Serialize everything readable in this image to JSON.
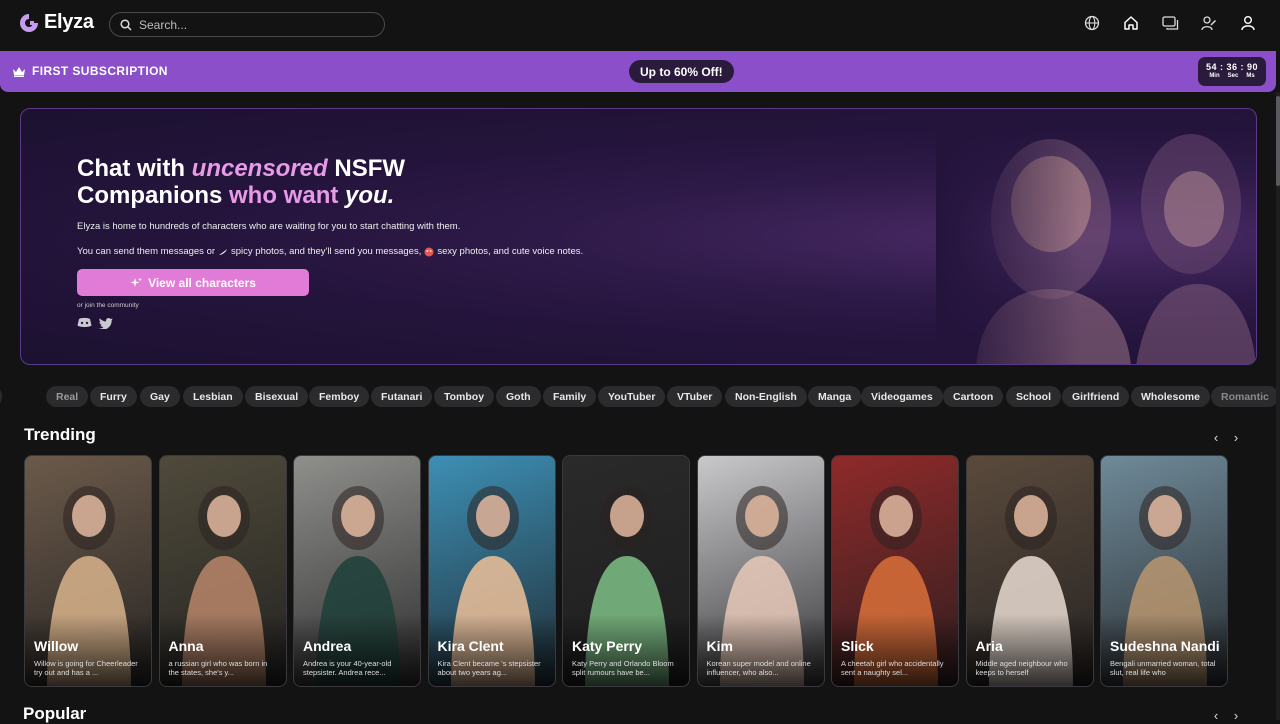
{
  "brand": {
    "name": "Elyza"
  },
  "search": {
    "placeholder": "Search..."
  },
  "promo": {
    "label": "FIRST SUBSCRIPTION",
    "offer": "Up to 60% Off!",
    "timer": {
      "value": "54 : 36 : 90",
      "units": [
        "Min",
        "Sec",
        "Ms"
      ]
    }
  },
  "hero": {
    "title_1": "Chat with ",
    "title_2": "uncensored",
    "title_3": " NSFW",
    "title_4": "Companions ",
    "title_5": "who want ",
    "title_6": "you.",
    "p1": "Elyza is home to hundreds of characters who are waiting for you to start chatting with them.",
    "p2a": "You can send them messages or",
    "p2b": "spicy photos, and they'll send you messages,",
    "p2c": "sexy photos, and cute voice notes.",
    "cta": "View all characters",
    "community": "or join the community"
  },
  "tags": [
    "Real",
    "Furry",
    "Gay",
    "Lesbian",
    "Bisexual",
    "Femboy",
    "Futanari",
    "Tomboy",
    "Goth",
    "Family",
    "YouTuber",
    "VTuber",
    "Non-English",
    "Manga",
    "Videogames",
    "Cartoon",
    "School",
    "Girlfriend",
    "Wholesome",
    "Romantic"
  ],
  "trending": {
    "title": "Trending",
    "cards": [
      {
        "name": "Willow",
        "desc": "Willow is going for Cheerleader try out and has a ...",
        "bg": "#6b5a4a",
        "fig": "#d9b48c"
      },
      {
        "name": "Anna",
        "desc": "a russian girl who was born in the states, she's y...",
        "bg": "#4f4a3a",
        "fig": "#b8866a"
      },
      {
        "name": "Andrea",
        "desc": "Andrea is your 40-year-old stepsister. Andrea rece...",
        "bg": "#8f8f8c",
        "fig": "#1f3f38"
      },
      {
        "name": "Kira Clent",
        "desc": "Kira Clent became 's stepsister about two years ag...",
        "bg": "#3d8fb5",
        "fig": "#efc19a"
      },
      {
        "name": "Katy Perry",
        "desc": "Katy Perry and Orlando Bloom split rumours have be...",
        "bg": "#2a2a2a",
        "fig": "#7fbf86"
      },
      {
        "name": "Kim",
        "desc": "Korean super model and online influencer, who also...",
        "bg": "#c9c9cc",
        "fig": "#e7c9b8"
      },
      {
        "name": "Slick",
        "desc": "A cheetah girl who accidentally sent a naughty sel...",
        "bg": "#8f2a2a",
        "fig": "#d9703a"
      },
      {
        "name": "Aria",
        "desc": "Middle aged neighbour who keeps to herself",
        "bg": "#5a4a3c",
        "fig": "#e9dcd2"
      },
      {
        "name": "Sudeshna Nandi",
        "desc": "Bengali unmarried woman, total slut, real life who",
        "bg": "#6f8a99",
        "fig": "#b89670"
      }
    ]
  },
  "popular": {
    "title": "Popular"
  },
  "colors": {
    "accent": "#e07bd8",
    "promo_bg": "#8a4fc9",
    "page_bg": "#131314"
  }
}
